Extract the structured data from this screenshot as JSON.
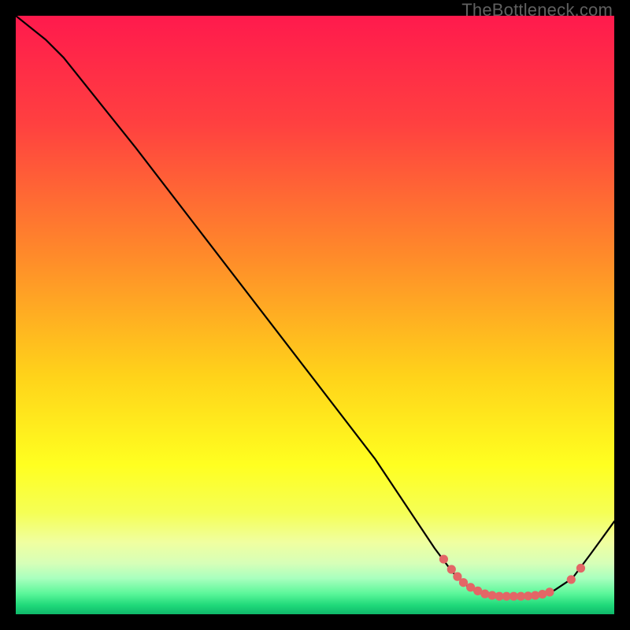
{
  "watermark": "TheBottleneck.com",
  "chart_data": {
    "type": "line",
    "title": "",
    "xlabel": "",
    "ylabel": "",
    "xlim": [
      0,
      100
    ],
    "ylim": [
      0,
      100
    ],
    "curve": [
      {
        "x": 0,
        "y": 100
      },
      {
        "x": 5,
        "y": 96
      },
      {
        "x": 8,
        "y": 93
      },
      {
        "x": 10,
        "y": 90.5
      },
      {
        "x": 20,
        "y": 78
      },
      {
        "x": 30,
        "y": 65
      },
      {
        "x": 40,
        "y": 52
      },
      {
        "x": 50,
        "y": 39
      },
      {
        "x": 60,
        "y": 26
      },
      {
        "x": 64,
        "y": 20
      },
      {
        "x": 70,
        "y": 11
      },
      {
        "x": 73,
        "y": 7
      },
      {
        "x": 76,
        "y": 4.2
      },
      {
        "x": 79,
        "y": 3.2
      },
      {
        "x": 83,
        "y": 3.0
      },
      {
        "x": 87,
        "y": 3.2
      },
      {
        "x": 90,
        "y": 4.0
      },
      {
        "x": 93,
        "y": 6.0
      },
      {
        "x": 96,
        "y": 10.0
      },
      {
        "x": 100,
        "y": 15.5
      }
    ],
    "markers": [
      {
        "x": 71.5,
        "y": 9.2
      },
      {
        "x": 72.8,
        "y": 7.5
      },
      {
        "x": 73.8,
        "y": 6.3
      },
      {
        "x": 74.8,
        "y": 5.3
      },
      {
        "x": 76.0,
        "y": 4.5
      },
      {
        "x": 77.2,
        "y": 3.9
      },
      {
        "x": 78.4,
        "y": 3.4
      },
      {
        "x": 79.6,
        "y": 3.15
      },
      {
        "x": 80.8,
        "y": 3.0
      },
      {
        "x": 82.0,
        "y": 3.0
      },
      {
        "x": 83.2,
        "y": 3.0
      },
      {
        "x": 84.4,
        "y": 3.0
      },
      {
        "x": 85.6,
        "y": 3.05
      },
      {
        "x": 86.8,
        "y": 3.15
      },
      {
        "x": 88.0,
        "y": 3.35
      },
      {
        "x": 89.2,
        "y": 3.7
      },
      {
        "x": 92.8,
        "y": 5.8
      },
      {
        "x": 94.4,
        "y": 7.7
      }
    ],
    "gradient_stops": [
      {
        "pct": 0,
        "color": "#ff1a4d"
      },
      {
        "pct": 18,
        "color": "#ff4040"
      },
      {
        "pct": 40,
        "color": "#ff8a2a"
      },
      {
        "pct": 60,
        "color": "#ffd21a"
      },
      {
        "pct": 75,
        "color": "#ffff20"
      },
      {
        "pct": 83,
        "color": "#f5ff55"
      },
      {
        "pct": 88,
        "color": "#f0ffa0"
      },
      {
        "pct": 91.5,
        "color": "#d6ffb8"
      },
      {
        "pct": 94,
        "color": "#a8ffbe"
      },
      {
        "pct": 96.5,
        "color": "#5cf79a"
      },
      {
        "pct": 98.5,
        "color": "#1fd97a"
      },
      {
        "pct": 100,
        "color": "#0fb86a"
      }
    ],
    "marker_color": "#e36666",
    "curve_color": "#000000"
  }
}
